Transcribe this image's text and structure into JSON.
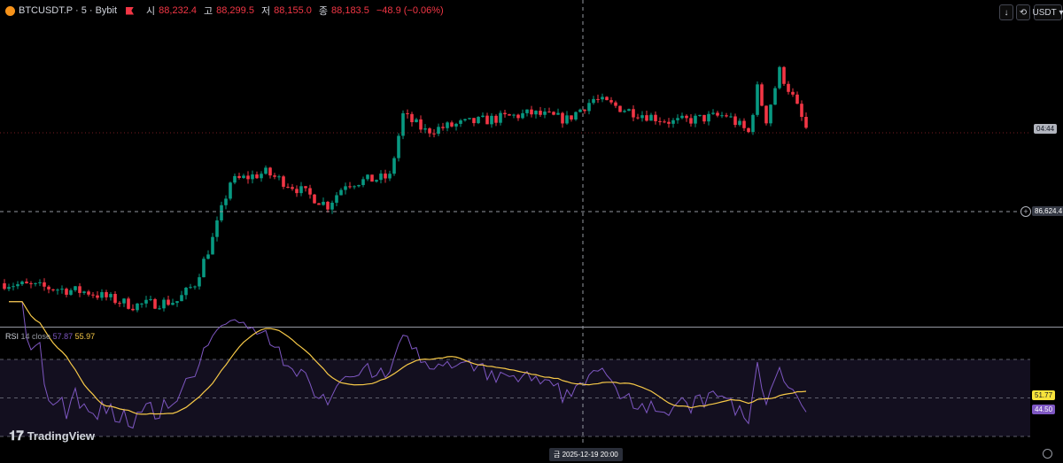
{
  "header": {
    "symbol": "BTCUSDT.P · 5 · Bybit",
    "open_label": "시",
    "open": "88,232.4",
    "high_label": "고",
    "high": "88,299.5",
    "low_label": "저",
    "low": "88,155.0",
    "close_label": "종",
    "close": "88,183.5",
    "change": "−48.9 (−0.06%)"
  },
  "toolbar": {
    "currency": "USDT",
    "icons": [
      "arrow-down-icon",
      "refresh-icon"
    ]
  },
  "price_axis": {
    "countdown": "04:44",
    "crosshair_price": "86,624.4"
  },
  "rsi": {
    "title": "RSI",
    "params": "14 close",
    "value": "57.87",
    "ma_value": "55.97",
    "tag_ma": "51.77",
    "tag_rsi": "44.50"
  },
  "time_axis": {
    "crosshair_label": "금 2025-12-19   20:00"
  },
  "brand": {
    "logo_text": "TradingView"
  },
  "colors": {
    "up": "#089981",
    "down": "#f23645",
    "rsi_line": "#7e57c2",
    "rsi_ma": "#f7c948",
    "rsi_band": "#130f1f"
  },
  "chart_data": {
    "type": "candlestick",
    "symbol": "BTCUSDT.P",
    "interval": "5",
    "last_close": 88183.5,
    "crosshair_price": 86624.4,
    "approx_close_path": [
      85208,
      85033,
      84770,
      84858,
      85208,
      86083,
      87221,
      87396,
      87133,
      86748,
      87186,
      87308,
      88533,
      88218,
      88358,
      88568,
      88446,
      88848,
      88621,
      88393,
      88533,
      88183,
      89058,
      88446,
      89408,
      88883,
      88183
    ],
    "indicator": {
      "name": "RSI",
      "length": 14,
      "source": "close",
      "levels": [
        70,
        50,
        30
      ],
      "last_rsi": 44.5,
      "last_ma": 51.77
    }
  }
}
